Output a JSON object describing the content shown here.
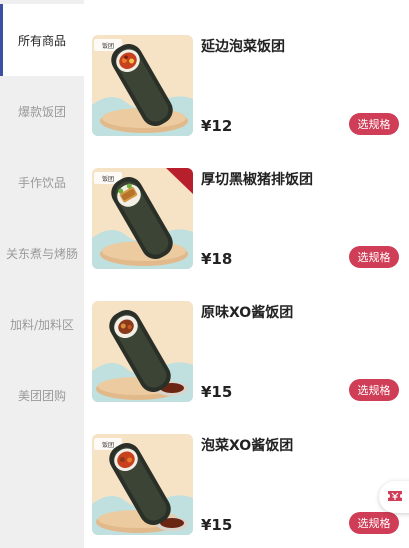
{
  "sidebar": {
    "categories": [
      {
        "label": "所有商品",
        "active": true
      },
      {
        "label": "爆款饭团",
        "active": false
      },
      {
        "label": "手作饮品",
        "active": false
      },
      {
        "label": "关东煮与烤肠",
        "active": false
      },
      {
        "label": "加料/加料区",
        "active": false
      },
      {
        "label": "美团团购",
        "active": false
      }
    ]
  },
  "products": [
    {
      "name": "延边泡菜饭团",
      "price": "¥12",
      "button": "选规格",
      "image_icon": "kimchi-rice-roll-image",
      "brand_tag": "饭团"
    },
    {
      "name": "厚切黑椒猪排饭团",
      "price": "¥18",
      "button": "选规格",
      "image_icon": "pork-cutlet-rice-roll-image",
      "brand_tag": "饭团"
    },
    {
      "name": "原味XO酱饭团",
      "price": "¥15",
      "button": "选规格",
      "image_icon": "xo-sauce-rice-roll-image",
      "brand_tag": "饭团"
    },
    {
      "name": "泡菜XO酱饭团",
      "price": "¥15",
      "button": "选规格",
      "image_icon": "kimchi-xo-rice-roll-image",
      "brand_tag": "饭团"
    }
  ],
  "floating_button": {
    "icon": "coupon-icon"
  },
  "colors": {
    "accent": "#cf3d56",
    "active_indicator": "#3b4fa3",
    "sidebar_bg": "#efefef"
  }
}
